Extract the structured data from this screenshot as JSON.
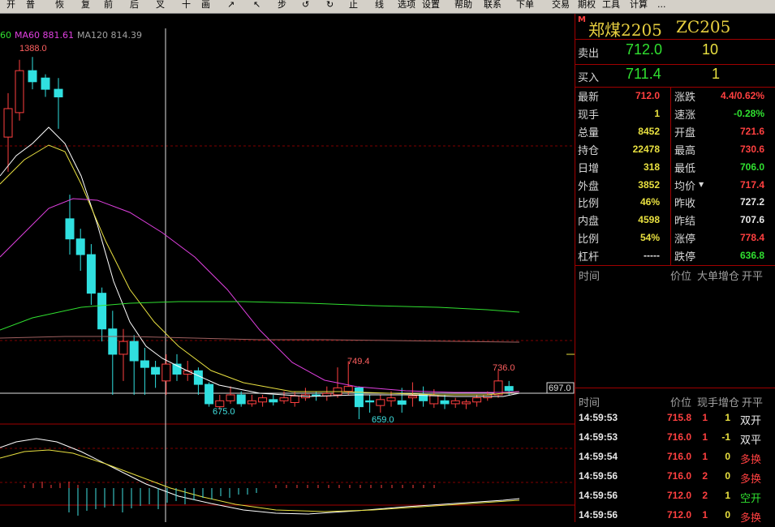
{
  "toolbar": {
    "buttons": [
      "开",
      "普",
      "恢",
      "复",
      "前",
      "后",
      "叉",
      "十",
      "画",
      "↗",
      "↖",
      "步",
      "↺",
      "↻",
      "止",
      "线",
      "选项",
      "设置",
      "帮助",
      "联系",
      "下单",
      "交易",
      "期权",
      "工具",
      "计算",
      "..."
    ]
  },
  "legend": {
    "items": [
      {
        "text": "60",
        "color": "#30e030"
      },
      {
        "text": "MA60 881.61",
        "color": "#e040e0"
      },
      {
        "text": "MA120 814.39",
        "color": "#a0a0a0"
      }
    ]
  },
  "chart_data": {
    "type": "candlestick",
    "annotations": [
      {
        "text": "1388.0",
        "value": 1388.0
      },
      {
        "text": "749.4",
        "value": 749.4
      },
      {
        "text": "736.0",
        "value": 736.0
      },
      {
        "text": "675.0",
        "value": 675.0
      },
      {
        "text": "659.0",
        "value": 659.0
      }
    ],
    "last_price_label": "697.0",
    "candles": [
      {
        "o": 1180,
        "c": 1250,
        "h": 1290,
        "l": 1100
      },
      {
        "o": 1240,
        "c": 1350,
        "h": 1380,
        "l": 1220
      },
      {
        "o": 1350,
        "c": 1320,
        "h": 1388,
        "l": 1300
      },
      {
        "o": 1330,
        "c": 1300,
        "h": 1340,
        "l": 1280
      },
      {
        "o": 1300,
        "c": 1280,
        "h": 1330,
        "l": 1200
      },
      {
        "o": 1000,
        "c": 960,
        "h": 1050,
        "l": 930
      },
      {
        "o": 960,
        "c": 930,
        "h": 980,
        "l": 900
      },
      {
        "o": 930,
        "c": 860,
        "h": 950,
        "l": 840
      },
      {
        "o": 860,
        "c": 800,
        "h": 870,
        "l": 780
      },
      {
        "o": 800,
        "c": 760,
        "h": 830,
        "l": 700
      },
      {
        "o": 760,
        "c": 780,
        "h": 800,
        "l": 720
      },
      {
        "o": 780,
        "c": 750,
        "h": 790,
        "l": 700
      },
      {
        "o": 750,
        "c": 740,
        "h": 770,
        "l": 700
      },
      {
        "o": 740,
        "c": 730,
        "h": 750,
        "l": 710
      },
      {
        "o": 720,
        "c": 745,
        "h": 760,
        "l": 700
      },
      {
        "o": 745,
        "c": 730,
        "h": 760,
        "l": 720
      },
      {
        "o": 730,
        "c": 735,
        "h": 750,
        "l": 720
      },
      {
        "o": 735,
        "c": 715,
        "h": 740,
        "l": 700
      },
      {
        "o": 715,
        "c": 685,
        "h": 718,
        "l": 680
      },
      {
        "o": 680,
        "c": 690,
        "h": 700,
        "l": 675
      },
      {
        "o": 690,
        "c": 700,
        "h": 712,
        "l": 685
      },
      {
        "o": 700,
        "c": 685,
        "h": 705,
        "l": 680
      },
      {
        "o": 685,
        "c": 690,
        "h": 700,
        "l": 680
      },
      {
        "o": 688,
        "c": 695,
        "h": 700,
        "l": 680
      },
      {
        "o": 692,
        "c": 688,
        "h": 700,
        "l": 682
      },
      {
        "o": 690,
        "c": 695,
        "h": 705,
        "l": 685
      },
      {
        "o": 687,
        "c": 698,
        "h": 705,
        "l": 680
      },
      {
        "o": 695,
        "c": 700,
        "h": 710,
        "l": 690
      },
      {
        "o": 700,
        "c": 698,
        "h": 705,
        "l": 690
      },
      {
        "o": 698,
        "c": 702,
        "h": 712,
        "l": 690
      },
      {
        "o": 700,
        "c": 710,
        "h": 740,
        "l": 695
      },
      {
        "o": 705,
        "c": 712,
        "h": 749.4,
        "l": 700
      },
      {
        "o": 710,
        "c": 680,
        "h": 712,
        "l": 659
      },
      {
        "o": 690,
        "c": 688,
        "h": 700,
        "l": 670
      },
      {
        "o": 682,
        "c": 692,
        "h": 700,
        "l": 670
      },
      {
        "o": 690,
        "c": 695,
        "h": 705,
        "l": 680
      },
      {
        "o": 690,
        "c": 684,
        "h": 710,
        "l": 670
      },
      {
        "o": 695,
        "c": 698,
        "h": 718,
        "l": 680
      },
      {
        "o": 700,
        "c": 690,
        "h": 712,
        "l": 680
      },
      {
        "o": 685,
        "c": 700,
        "h": 708,
        "l": 678
      },
      {
        "o": 690,
        "c": 685,
        "h": 700,
        "l": 676
      },
      {
        "o": 685,
        "c": 690,
        "h": 695,
        "l": 678
      },
      {
        "o": 685,
        "c": 688,
        "h": 692,
        "l": 676
      },
      {
        "o": 688,
        "c": 695,
        "h": 700,
        "l": 680
      },
      {
        "o": 695,
        "c": 700,
        "h": 705,
        "l": 690
      },
      {
        "o": 700,
        "c": 720,
        "h": 736,
        "l": 695
      },
      {
        "o": 712,
        "c": 706,
        "h": 720,
        "l": 700
      }
    ]
  },
  "panel": {
    "title": "郑煤2205",
    "code": "ZC205",
    "sell_label": "卖出",
    "sell_price": "712.0",
    "sell_vol": "10",
    "buy_label": "买入",
    "buy_price": "711.4",
    "buy_vol": "1",
    "rows": [
      {
        "l1": "最新",
        "v1": "712.0",
        "c1": "red",
        "l2": "涨跌",
        "v2": "4.4/0.62%",
        "c2": "red"
      },
      {
        "l1": "现手",
        "v1": "1",
        "c1": "yellow",
        "l2": "速涨",
        "v2": "-0.28%",
        "c2": "green"
      },
      {
        "l1": "总量",
        "v1": "8452",
        "c1": "yellow",
        "l2": "开盘",
        "v2": "721.6",
        "c2": "red"
      },
      {
        "l1": "持仓",
        "v1": "22478",
        "c1": "yellow",
        "l2": "最高",
        "v2": "730.6",
        "c2": "red"
      },
      {
        "l1": "日增",
        "v1": "318",
        "c1": "yellow",
        "l2": "最低",
        "v2": "706.0",
        "c2": "green"
      },
      {
        "l1": "外盘",
        "v1": "3852",
        "c1": "yellow",
        "l2": "均价",
        "v2": "717.4",
        "c2": "red"
      },
      {
        "l1": "比例",
        "v1": "46%",
        "c1": "yellow",
        "l2": "昨收",
        "v2": "727.2",
        "c2": "white"
      },
      {
        "l1": "内盘",
        "v1": "4598",
        "c1": "yellow",
        "l2": "昨结",
        "v2": "707.6",
        "c2": "white"
      },
      {
        "l1": "比例",
        "v1": "54%",
        "c1": "yellow",
        "l2": "涨停",
        "v2": "778.4",
        "c2": "red"
      },
      {
        "l1": "杠杆",
        "v1": "-----",
        "c1": "white",
        "l2": "跌停",
        "v2": "636.8",
        "c2": "green"
      }
    ],
    "big_header": [
      "时间",
      "价位",
      "大单",
      "增仓",
      "开平"
    ],
    "tick_header": [
      "时间",
      "价位",
      "现手",
      "增仓",
      "开平"
    ],
    "ticks": [
      {
        "time": "14:59:53",
        "price": "715.8",
        "pc": "red",
        "vol": "1",
        "chg": "1",
        "type": "双开",
        "tc": "white"
      },
      {
        "time": "14:59:53",
        "price": "716.0",
        "pc": "red",
        "vol": "1",
        "chg": "-1",
        "type": "双平",
        "tc": "white"
      },
      {
        "time": "14:59:54",
        "price": "716.0",
        "pc": "red",
        "vol": "1",
        "chg": "0",
        "type": "多换",
        "tc": "red"
      },
      {
        "time": "14:59:56",
        "price": "716.0",
        "pc": "red",
        "vol": "2",
        "chg": "0",
        "type": "多换",
        "tc": "red"
      },
      {
        "time": "14:59:56",
        "price": "712.0",
        "pc": "red",
        "vol": "2",
        "chg": "1",
        "type": "空开",
        "tc": "green"
      },
      {
        "time": "14:59:56",
        "price": "712.0",
        "pc": "red",
        "vol": "1",
        "chg": "0",
        "type": "多换",
        "tc": "red"
      }
    ]
  }
}
